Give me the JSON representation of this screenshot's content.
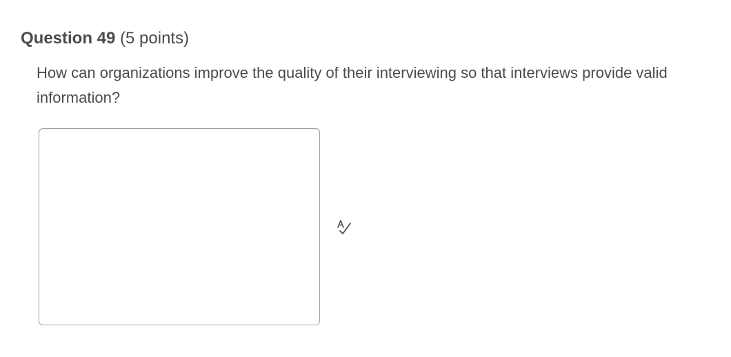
{
  "question": {
    "title": "Question 49",
    "points": "(5 points)",
    "prompt": "How can organizations improve the quality of their interviewing so that interviews provide valid information?"
  },
  "answer": {
    "value": "",
    "placeholder": ""
  },
  "tools": {
    "spellcheck_icon": "spellcheck-icon"
  },
  "colors": {
    "text": "#494c4e",
    "border": "#9ea0a3"
  }
}
